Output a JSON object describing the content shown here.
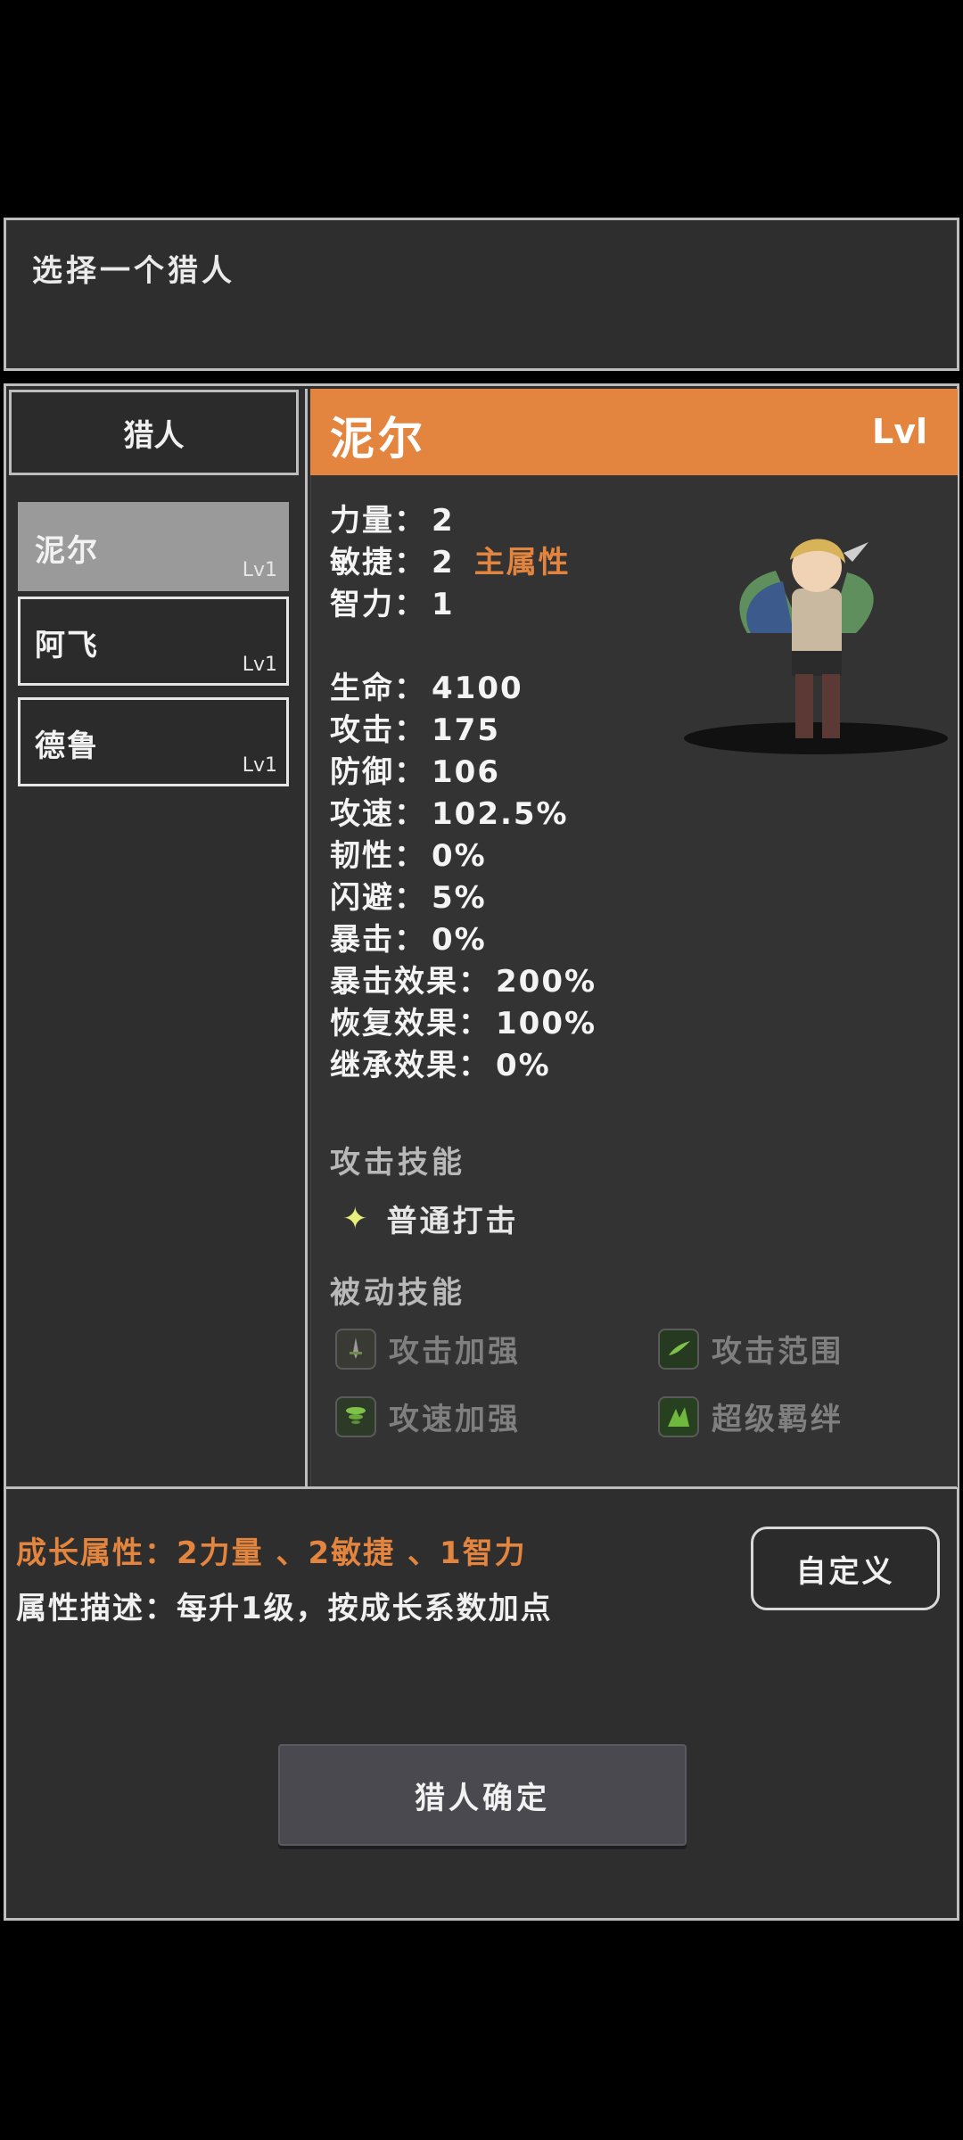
{
  "header": {
    "title": "选择一个猎人"
  },
  "hunter_list": {
    "title": "猎人",
    "items": [
      {
        "name": "泥尔",
        "level": "Lv1",
        "selected": true
      },
      {
        "name": "阿飞",
        "level": "Lv1",
        "selected": false
      },
      {
        "name": "德鲁",
        "level": "Lv1",
        "selected": false
      }
    ]
  },
  "detail": {
    "name": "泥尔",
    "level": "Lvl",
    "attributes": [
      {
        "label": "力量：",
        "value": "2"
      },
      {
        "label": "敏捷：",
        "value": "2",
        "tag": "主属性"
      },
      {
        "label": "智力：",
        "value": "1"
      }
    ],
    "stats": [
      {
        "label": "生命：",
        "value": "4100"
      },
      {
        "label": "攻击：",
        "value": "175"
      },
      {
        "label": "防御：",
        "value": "106"
      },
      {
        "label": "攻速：",
        "value": "102.5%"
      },
      {
        "label": "韧性：",
        "value": "0%"
      },
      {
        "label": "闪避：",
        "value": "5%"
      },
      {
        "label": "暴击：",
        "value": "0%"
      },
      {
        "label": "暴击效果：",
        "value": "200%"
      },
      {
        "label": "恢复效果：",
        "value": "100%"
      },
      {
        "label": "继承效果：",
        "value": "0%"
      }
    ],
    "attack_skill_title": "攻击技能",
    "attack_skills": [
      {
        "name": "普通打击",
        "icon": "plus-icon"
      }
    ],
    "passive_skill_title": "被动技能",
    "passive_skills": [
      {
        "name": "攻击加强",
        "icon": "sword-icon"
      },
      {
        "name": "攻击范围",
        "icon": "range-icon"
      },
      {
        "name": "攻速加强",
        "icon": "whirlwind-icon"
      },
      {
        "name": "超级羁绊",
        "icon": "bond-icon"
      }
    ]
  },
  "growth": {
    "growth_text": "成长属性：2力量 、2敏捷 、1智力",
    "description_text": "属性描述：每升1级，按成长系数加点"
  },
  "buttons": {
    "custom": "自定义",
    "confirm": "猎人确定"
  },
  "colors": {
    "accent": "#e3853e",
    "panel": "#2e2e2e",
    "border": "#bdbdbd"
  }
}
